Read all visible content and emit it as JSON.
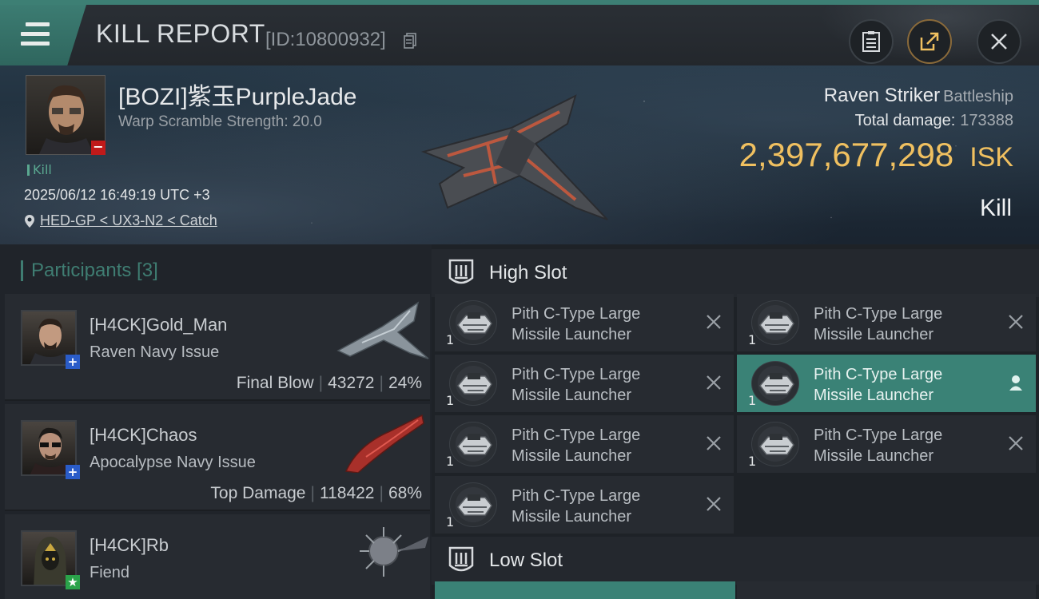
{
  "header": {
    "title": "KILL REPORT",
    "report_id": "[ID:10800932]"
  },
  "victim": {
    "name": "[BOZI]紫玉PurpleJade",
    "warp_scramble": "Warp Scramble Strength: 20.0",
    "result_tag": "Kill",
    "time": "2025/06/12 16:49:19 UTC +3",
    "location": "HED-GP < UX3-N2 < Catch",
    "badge": "−"
  },
  "ship": {
    "name": "Raven Striker",
    "class": "Battleship",
    "total_damage_label": "Total damage:",
    "total_damage_value": "173388",
    "isk_value": "2,397,677,298",
    "isk_unit": "ISK",
    "result": "Kill"
  },
  "participants": {
    "header": "Participants [3]",
    "list": [
      {
        "name": "[H4CK]Gold_Man",
        "ship": "Raven Navy Issue",
        "role": "Final Blow",
        "damage": "43272",
        "percent": "24%",
        "badge": "+"
      },
      {
        "name": "[H4CK]Chaos",
        "ship": "Apocalypse Navy Issue",
        "role": "Top Damage",
        "damage": "118422",
        "percent": "68%",
        "badge": "+"
      },
      {
        "name": "[H4CK]Rb",
        "ship": "Fiend",
        "role": "",
        "damage": "",
        "percent": "",
        "badge": "★"
      }
    ]
  },
  "slots": {
    "high_label": "High Slot",
    "low_label": "Low Slot",
    "high_modules": [
      {
        "line1": "Pith C-Type Large",
        "line2": "Missile Launcher",
        "qty": "1",
        "state": "destroyed"
      },
      {
        "line1": "Pith C-Type Large",
        "line2": "Missile Launcher",
        "qty": "1",
        "state": "destroyed"
      },
      {
        "line1": "Pith C-Type Large",
        "line2": "Missile Launcher",
        "qty": "1",
        "state": "destroyed"
      },
      {
        "line1": "Pith C-Type Large",
        "line2": "Missile Launcher",
        "qty": "1",
        "state": "dropped"
      },
      {
        "line1": "Pith C-Type Large",
        "line2": "Missile Launcher",
        "qty": "1",
        "state": "destroyed"
      },
      {
        "line1": "Pith C-Type Large",
        "line2": "Missile Launcher",
        "qty": "1",
        "state": "destroyed"
      },
      {
        "line1": "Pith C-Type Large",
        "line2": "Missile Launcher",
        "qty": "1",
        "state": "destroyed"
      }
    ]
  },
  "colors": {
    "accent": "#3f7d72",
    "isk": "#f0c060",
    "badge_red": "#c01a1a",
    "badge_blue": "#2a5cc8",
    "badge_green": "#2aa34a"
  },
  "icons": [
    "menu-icon",
    "copy-icon",
    "clipboard-icon",
    "share-icon",
    "close-icon",
    "location-pin-icon",
    "high-slot-icon",
    "low-slot-icon",
    "destroyed-x-icon",
    "person-icon"
  ]
}
